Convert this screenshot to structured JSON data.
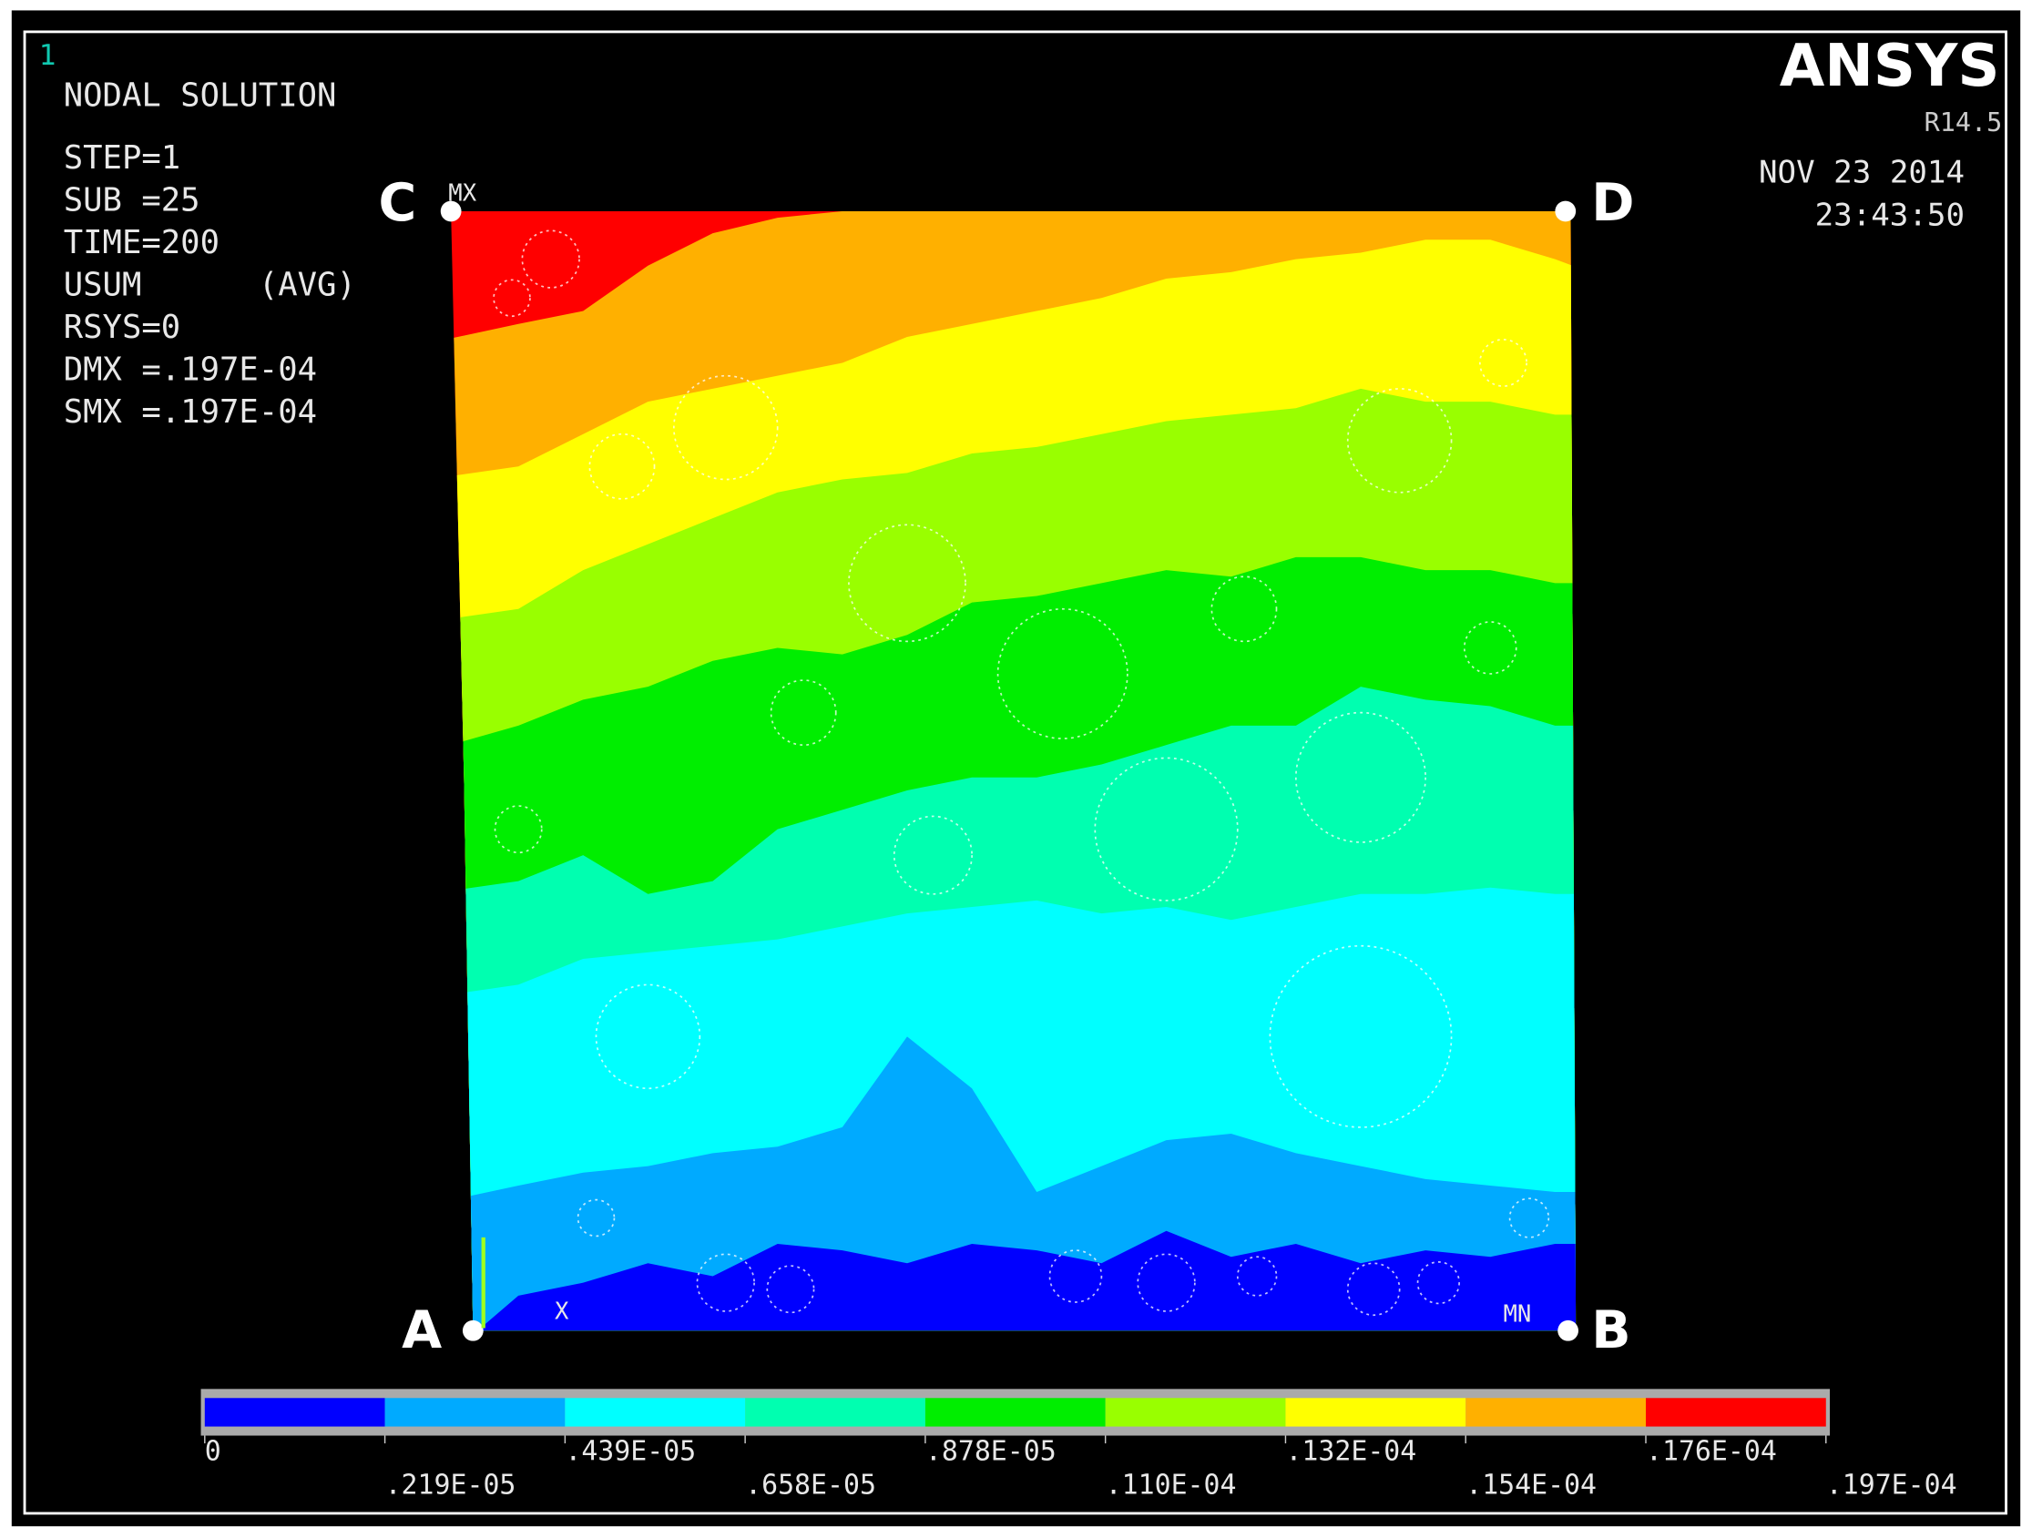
{
  "window_number": "1",
  "info": {
    "title": "NODAL SOLUTION",
    "lines": [
      "STEP=1",
      "SUB =25",
      "TIME=200",
      "USUM      (AVG)",
      "RSYS=0",
      "DMX =.197E-04",
      "SMX =.197E-04"
    ]
  },
  "brand": {
    "name": "ANSYS",
    "version": "R14.5"
  },
  "datetime": {
    "date": "NOV 23 2014",
    "time": "23:43:50"
  },
  "corners": {
    "c": "C",
    "d": "D",
    "a": "A",
    "b": "B"
  },
  "markers": {
    "max": "MX",
    "min": "MN",
    "axis": "X"
  },
  "chart_data": {
    "type": "heatmap",
    "title": "NODAL SOLUTION USUM (AVG)",
    "quantity": "USUM",
    "min": 0,
    "max": 1.97e-05,
    "levels": [
      0,
      2.19e-06,
      4.39e-06,
      6.58e-06,
      8.78e-06,
      1.1e-05,
      1.32e-05,
      1.54e-05,
      1.76e-05,
      1.97e-05
    ],
    "level_labels": [
      "0",
      ".219E-05",
      ".439E-05",
      ".658E-05",
      ".878E-05",
      ".110E-04",
      ".132E-04",
      ".154E-04",
      ".176E-04",
      ".197E-04"
    ],
    "band_colors": [
      "#0000ff",
      "#00aaff",
      "#00ffff",
      "#00ffb0",
      "#00ee00",
      "#99ff00",
      "#ffff00",
      "#ffb000",
      "#ff0000"
    ],
    "gradient_direction": "increasing from bottom (A-B) to top-left corner (C)"
  }
}
